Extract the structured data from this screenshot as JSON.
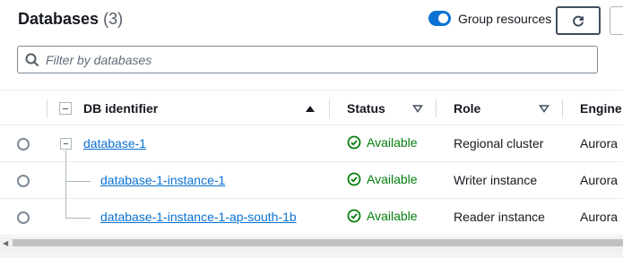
{
  "header": {
    "title": "Databases",
    "count": "(3)",
    "group_resources_label": "Group resources",
    "group_resources_on": true
  },
  "search": {
    "placeholder": "Filter by databases",
    "value": ""
  },
  "table": {
    "columns": {
      "db_identifier": "DB identifier",
      "status": "Status",
      "role": "Role",
      "engine": "Engine"
    },
    "rows": [
      {
        "identifier": "database-1",
        "status": "Available",
        "role": "Regional cluster",
        "engine": "Aurora"
      },
      {
        "identifier": "database-1-instance-1",
        "status": "Available",
        "role": "Writer instance",
        "engine": "Aurora"
      },
      {
        "identifier": "database-1-instance-1-ap-south-1b",
        "status": "Available",
        "role": "Reader instance",
        "engine": "Aurora"
      }
    ]
  },
  "colors": {
    "accent": "#0972d3",
    "status_available": "#037f0c",
    "text": "#16191f"
  },
  "icons": [
    "refresh-icon",
    "search-icon",
    "sort-asc-icon",
    "filter-caret-icon",
    "check-circle-icon",
    "scroll-left-icon"
  ]
}
